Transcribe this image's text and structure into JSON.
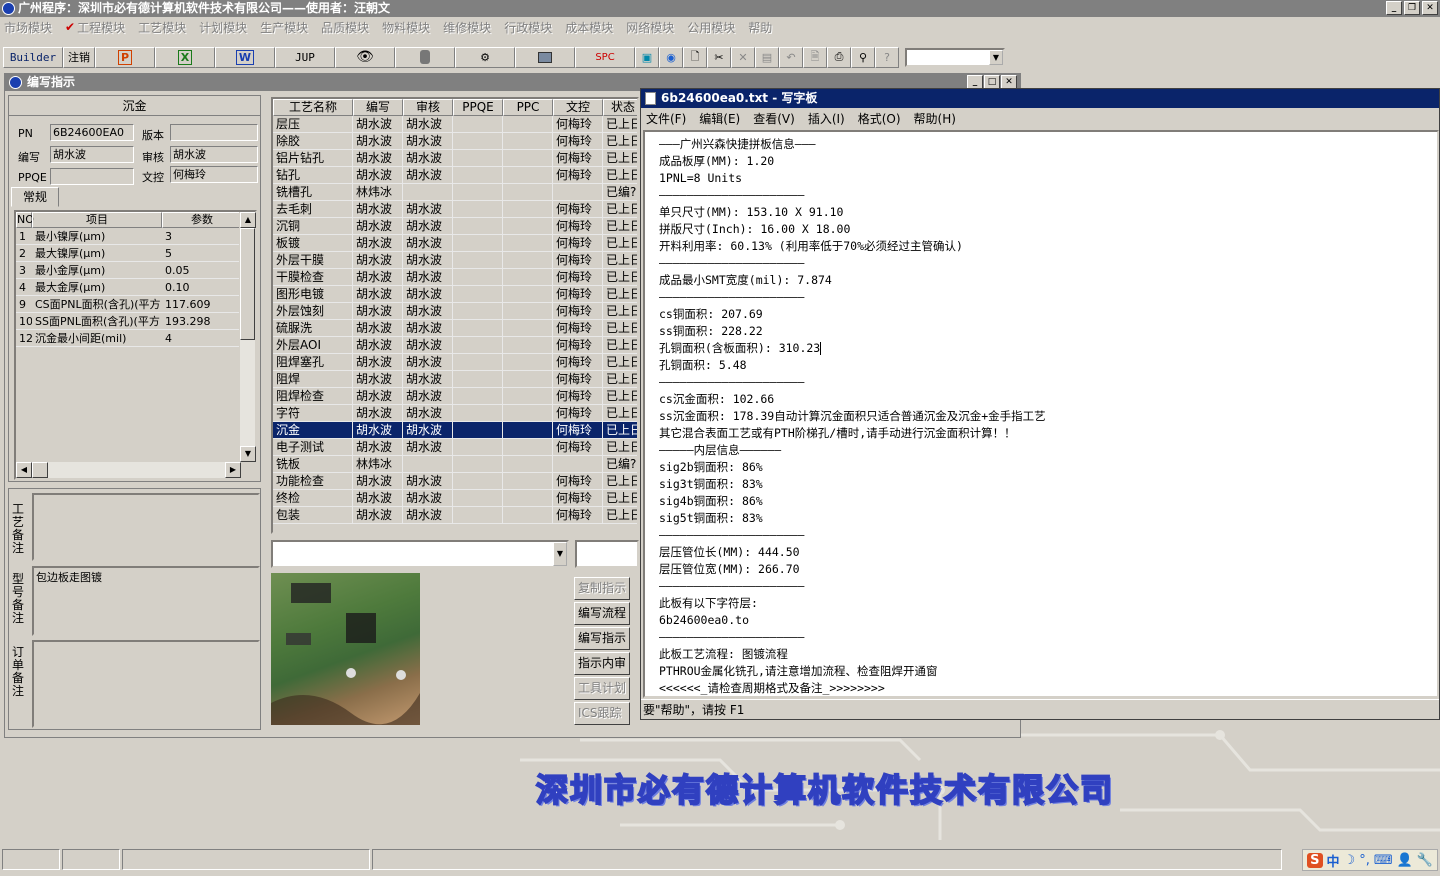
{
  "app": {
    "title": "广州程序：深圳市必有德计算机软件技术有限公司——使用者：汪朝文"
  },
  "menubar": [
    "市场模块",
    "工程模块",
    "工艺模块",
    "计划模块",
    "生产模块",
    "品质模块",
    "物料模块",
    "维修模块",
    "行政模块",
    "成本模块",
    "网络模块",
    "公用模块",
    "帮助"
  ],
  "toolbar": {
    "builder": "Builder",
    "logout": "注销",
    "jup": "JUP",
    "spc": "SPC"
  },
  "child": {
    "title": "编写指示"
  },
  "left": {
    "header": "沉金",
    "pn_label": "PN",
    "pn_value": "6B24600EA0",
    "version_label": "版本",
    "version_value": "",
    "writer_label": "编写",
    "writer_value": "胡水波",
    "auditor_label": "审核",
    "auditor_value": "胡水波",
    "ppqe_label": "PPQE",
    "ppqe_value": "",
    "control_label": "文控",
    "control_value": "何梅玲",
    "tab": "常规",
    "cols": [
      "NO",
      "项目",
      "参数"
    ],
    "rows": [
      [
        "1",
        "最小镍厚(μm)",
        "3"
      ],
      [
        "2",
        "最大镍厚(μm)",
        "5"
      ],
      [
        "3",
        "最小金厚(μm)",
        "0.05"
      ],
      [
        "4",
        "最大金厚(μm)",
        "0.10"
      ],
      [
        "9",
        "CS面PNL面积(含孔)(平方",
        "117.609"
      ],
      [
        "10",
        "SS面PNL面积(含孔)(平方",
        "193.298"
      ],
      [
        "12",
        "沉金最小间距(mil)",
        "4"
      ]
    ]
  },
  "remarks": {
    "process_label": "工艺备注",
    "process_value": "",
    "model_label": "型号备注",
    "model_value": "包边板走图镀",
    "order_label": "订单备注",
    "order_value": ""
  },
  "process": {
    "cols": [
      "工艺名称",
      "编写",
      "审核",
      "PPQE",
      "PPC",
      "文控",
      "状态"
    ],
    "rows": [
      [
        "层压",
        "胡水波",
        "胡水波",
        "",
        "",
        "何梅玲",
        "已上日"
      ],
      [
        "除胶",
        "胡水波",
        "胡水波",
        "",
        "",
        "何梅玲",
        "已上日"
      ],
      [
        "铝片钻孔",
        "胡水波",
        "胡水波",
        "",
        "",
        "何梅玲",
        "已上日"
      ],
      [
        "钻孔",
        "胡水波",
        "胡水波",
        "",
        "",
        "何梅玲",
        "已上日"
      ],
      [
        "铣槽孔",
        "林炜冰",
        "",
        "",
        "",
        "",
        "已编?"
      ],
      [
        "去毛刺",
        "胡水波",
        "胡水波",
        "",
        "",
        "何梅玲",
        "已上日"
      ],
      [
        "沉铜",
        "胡水波",
        "胡水波",
        "",
        "",
        "何梅玲",
        "已上日"
      ],
      [
        "板镀",
        "胡水波",
        "胡水波",
        "",
        "",
        "何梅玲",
        "已上日"
      ],
      [
        "外层干膜",
        "胡水波",
        "胡水波",
        "",
        "",
        "何梅玲",
        "已上日"
      ],
      [
        "干膜检查",
        "胡水波",
        "胡水波",
        "",
        "",
        "何梅玲",
        "已上日"
      ],
      [
        "图形电镀",
        "胡水波",
        "胡水波",
        "",
        "",
        "何梅玲",
        "已上日"
      ],
      [
        "外层蚀刻",
        "胡水波",
        "胡水波",
        "",
        "",
        "何梅玲",
        "已上日"
      ],
      [
        "硫脲洗",
        "胡水波",
        "胡水波",
        "",
        "",
        "何梅玲",
        "已上日"
      ],
      [
        "外层AOI",
        "胡水波",
        "胡水波",
        "",
        "",
        "何梅玲",
        "已上日"
      ],
      [
        "阻焊塞孔",
        "胡水波",
        "胡水波",
        "",
        "",
        "何梅玲",
        "已上日"
      ],
      [
        "阻焊",
        "胡水波",
        "胡水波",
        "",
        "",
        "何梅玲",
        "已上日"
      ],
      [
        "阻焊检查",
        "胡水波",
        "胡水波",
        "",
        "",
        "何梅玲",
        "已上日"
      ],
      [
        "字符",
        "胡水波",
        "胡水波",
        "",
        "",
        "何梅玲",
        "已上日"
      ],
      [
        "沉金",
        "胡水波",
        "胡水波",
        "",
        "",
        "何梅玲",
        "已上日"
      ],
      [
        "电子测试",
        "胡水波",
        "胡水波",
        "",
        "",
        "何梅玲",
        "已上日"
      ],
      [
        "铣板",
        "林炜冰",
        "",
        "",
        "",
        "",
        "已编?"
      ],
      [
        "功能检查",
        "胡水波",
        "胡水波",
        "",
        "",
        "何梅玲",
        "已上日"
      ],
      [
        "终检",
        "胡水波",
        "胡水波",
        "",
        "",
        "何梅玲",
        "已上日"
      ],
      [
        "包装",
        "胡水波",
        "胡水波",
        "",
        "",
        "何梅玲",
        "已上日"
      ]
    ],
    "selected": "沉金"
  },
  "buttons": [
    "复制指示",
    "编写流程",
    "编写指示",
    "指示内审",
    "工具计划",
    "ICS跟踪"
  ],
  "wordpad": {
    "title": "6b24600ea0.txt - 写字板",
    "menu": [
      "文件(F)",
      "编辑(E)",
      "查看(V)",
      "插入(I)",
      "格式(O)",
      "帮助(H)"
    ],
    "lines": [
      "———广州兴森快捷拼板信息———",
      "成品板厚(MM): 1.20",
      "1PNL=8 Units",
      "—————————————————————",
      "单只尺寸(MM): 153.10 X 91.10",
      "拼版尺寸(Inch): 16.00 X 18.00",
      "开料利用率: 60.13% (利用率低于70%必须经过主管确认)",
      "—————————————————————",
      "成品最小SMT宽度(mil): 7.874",
      "—————————————————————",
      "cs铜面积: 207.69",
      "ss铜面积: 228.22",
      "孔铜面积(含板面积): 310.23",
      "孔铜面积: 5.48",
      "—————————————————————",
      "cs沉金面积: 102.66",
      "ss沉金面积: 178.39自动计算沉金面积只适合普通沉金及沉金+金手指工艺",
      "其它混合表面工艺或有PTH阶梯孔/槽时,请手动进行沉金面积计算！！",
      "—————内层信息——————",
      "sig2b铜面积: 86%",
      "sig3t铜面积: 83%",
      "sig4b铜面积: 86%",
      "sig5t铜面积: 83%",
      "—————————————————————",
      "层压管位长(MM): 444.50",
      "层压管位宽(MM): 266.70",
      "—————————————————————",
      "此板有以下字符层:",
      "6b24600ea0.to",
      "—————————————————————",
      "此板工艺流程: 图镀流程",
      "PTHROU金属化铣孔,请注意增加流程、检查阻焊开通窗",
      "<<<<<<_请检查周期格式及备注_>>>>>>>>"
    ],
    "status": "要\"帮助\"，请按 F1"
  },
  "company": "深圳市必有德计算机软件技术有限公司",
  "tray": {
    "ime": "中"
  }
}
